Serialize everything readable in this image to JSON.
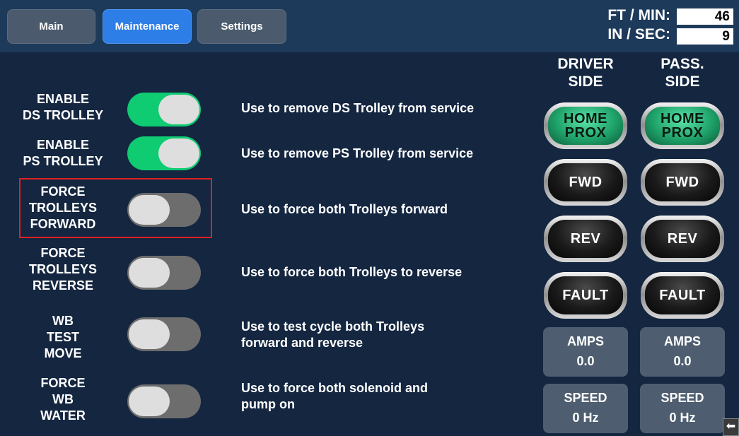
{
  "tabs": [
    {
      "label": "Main",
      "active": false
    },
    {
      "label": "Maintenance",
      "active": true
    },
    {
      "label": "Settings",
      "active": false
    }
  ],
  "rates": {
    "ft_min_label": "FT / MIN:",
    "ft_min_value": "46",
    "in_sec_label": "IN / SEC:",
    "in_sec_value": "9"
  },
  "controls": [
    {
      "label_lines": [
        "ENABLE",
        "DS TROLLEY"
      ],
      "state": "on",
      "desc_lines": [
        "Use to remove DS Trolley from service"
      ]
    },
    {
      "label_lines": [
        "ENABLE",
        "PS TROLLEY"
      ],
      "state": "on",
      "desc_lines": [
        "Use to remove PS Trolley from service"
      ]
    },
    {
      "label_lines": [
        "FORCE",
        "TROLLEYS",
        "FORWARD"
      ],
      "state": "off",
      "desc_lines": [
        "Use to force both Trolleys forward"
      ],
      "highlighted": true
    },
    {
      "label_lines": [
        "FORCE",
        "TROLLEYS",
        "REVERSE"
      ],
      "state": "off",
      "desc_lines": [
        "Use to force both Trolleys to reverse"
      ]
    },
    {
      "label_lines": [
        "WB",
        "TEST",
        "MOVE"
      ],
      "state": "off",
      "desc_lines": [
        "Use to test cycle both Trolleys",
        "forward and reverse"
      ]
    },
    {
      "label_lines": [
        "FORCE",
        "WB",
        "WATER"
      ],
      "state": "off",
      "desc_lines": [
        "Use to force both solenoid and",
        "pump on"
      ]
    }
  ],
  "sides": {
    "driver": {
      "header_lines": [
        "DRIVER",
        "SIDE"
      ],
      "indicators": [
        {
          "lines": [
            "HOME",
            "PROX"
          ],
          "state": "green"
        },
        {
          "lines": [
            "FWD"
          ],
          "state": "dark"
        },
        {
          "lines": [
            "REV"
          ],
          "state": "dark"
        },
        {
          "lines": [
            "FAULT"
          ],
          "state": "dark"
        }
      ],
      "amps_label": "AMPS",
      "amps_value": "0.0",
      "speed_label": "SPEED",
      "speed_value": "0 Hz"
    },
    "pass": {
      "header_lines": [
        "PASS.",
        "SIDE"
      ],
      "indicators": [
        {
          "lines": [
            "HOME",
            "PROX"
          ],
          "state": "green"
        },
        {
          "lines": [
            "FWD"
          ],
          "state": "dark"
        },
        {
          "lines": [
            "REV"
          ],
          "state": "dark"
        },
        {
          "lines": [
            "FAULT"
          ],
          "state": "dark"
        }
      ],
      "amps_label": "AMPS",
      "amps_value": "0.0",
      "speed_label": "SPEED",
      "speed_value": "0 Hz"
    }
  },
  "colors": {
    "background": "#142640",
    "topbar": "#1d3a5a",
    "tab_active": "#2e7ee8",
    "tab_inactive": "#4b5b6d",
    "toggle_on": "#0fcb72",
    "toggle_off": "#6d6d6d",
    "highlight_border": "#e02020",
    "panel": "#4e5e70"
  },
  "icons": {
    "corner": "back-arrow-icon"
  }
}
